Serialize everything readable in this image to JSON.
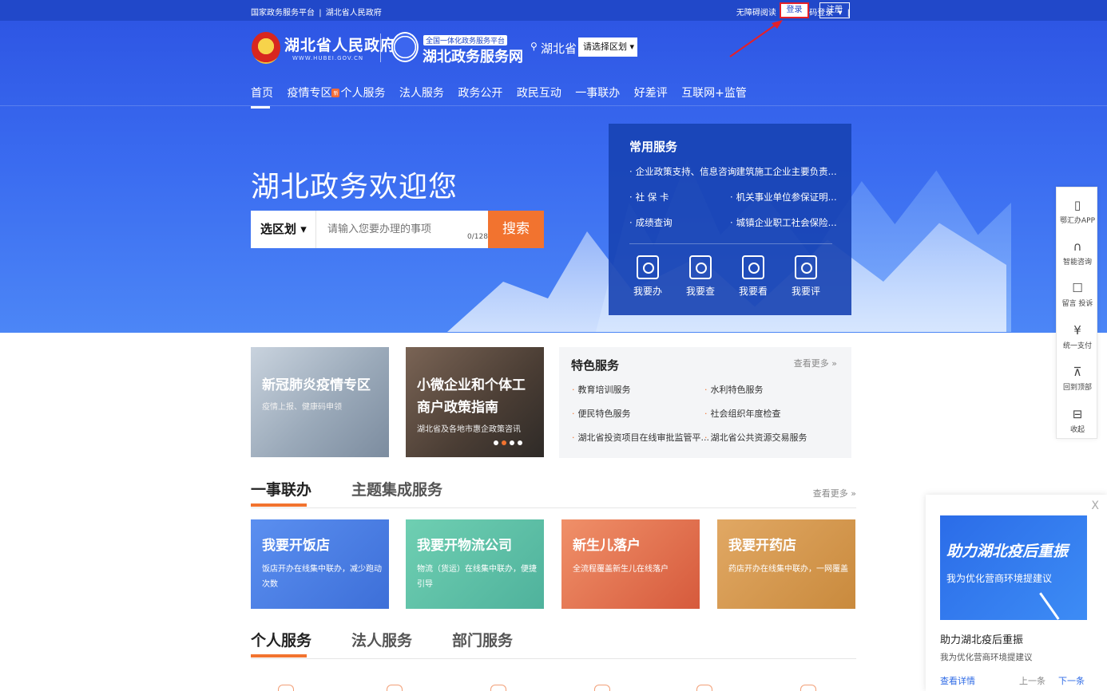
{
  "topbar": {
    "left_links": [
      "国家政务服务平台",
      "|",
      "湖北省人民政府"
    ],
    "accessibility": "无障碍阅读",
    "sep1": "|",
    "scan_login": "扫码登录",
    "sep2": "|",
    "login": "登录",
    "register": "注册"
  },
  "header": {
    "gov_title": "湖北省人民政府",
    "gov_url": "WWW.HUBEI.GOV.CN",
    "portal_tag": "全国一体化政务服务平台",
    "portal_title": "湖北政务服务网",
    "location": "湖北省",
    "region_select": "请选择区划 ▾"
  },
  "nav": {
    "items": [
      "首页",
      "疫情专区",
      "个人服务",
      "法人服务",
      "政务公开",
      "政民互动",
      "一事联办",
      "好差评",
      "互联网+监管"
    ],
    "new_tag": "新"
  },
  "hero": {
    "welcome": "湖北政务欢迎您",
    "search_region": "选区划 ▾",
    "search_placeholder": "请输入您要办理的事项",
    "search_count": "0/128",
    "search_button": "搜索"
  },
  "common_services": {
    "title": "常用服务",
    "links": [
      "企业政策支持、信息咨询",
      "建筑施工企业主要负责...",
      "社 保 卡",
      "机关事业单位参保证明...",
      "成绩查询",
      "城镇企业职工社会保险..."
    ],
    "actions": [
      "我要办",
      "我要查",
      "我要看",
      "我要评"
    ]
  },
  "float_toolbar": {
    "items": [
      "鄂汇办APP",
      "智能咨询",
      "留言 投诉",
      "统一支付",
      "回到顶部",
      "收起"
    ],
    "icons": [
      "phone-icon",
      "headset-icon",
      "message-icon",
      "yuan-icon",
      "top-icon",
      "collapse-icon"
    ],
    "glyphs": [
      "▯",
      "∩",
      "☐",
      "¥",
      "⊼",
      "⊟"
    ]
  },
  "feature_cards": [
    {
      "title": "新冠肺炎疫情专区",
      "sub": "疫情上报、健康码申领"
    },
    {
      "title": "小微企业和个体工商户政策指南",
      "sub": "湖北省及各地市惠企政策咨讯"
    }
  ],
  "special_services": {
    "title": "特色服务",
    "more": "查看更多 »",
    "items": [
      "教育培训服务",
      "水利特色服务",
      "便民特色服务",
      "社会组织年度检查",
      "湖北省投资项目在线审批监管平...",
      "湖北省公共资源交易服务"
    ]
  },
  "section1": {
    "tabs": [
      "一事联办",
      "主题集成服务"
    ],
    "more": "查看更多 »",
    "cards": [
      {
        "title": "我要开饭店",
        "desc": "饭店开办在线集中联办，减少跑动次数"
      },
      {
        "title": "我要开物流公司",
        "desc": "物流（货运）在线集中联办，便捷引导"
      },
      {
        "title": "新生儿落户",
        "desc": "全流程覆盖新生儿在线落户"
      },
      {
        "title": "我要开药店",
        "desc": "药店开办在线集中联办，一网覆盖"
      }
    ]
  },
  "section2": {
    "tabs": [
      "个人服务",
      "法人服务",
      "部门服务"
    ]
  },
  "popup": {
    "close": "X",
    "banner_title": "助力湖北疫后重振",
    "banner_sub": "我为优化营商环境提建议",
    "title": "助力湖北疫后重振",
    "sub": "我为优化营商环境提建议",
    "link": "查看详情",
    "prev": "上一条",
    "next": "下一条"
  },
  "colors": {
    "brand_blue": "#2148c9",
    "accent_orange": "#f2732f",
    "annotation_red": "#e4202a"
  }
}
